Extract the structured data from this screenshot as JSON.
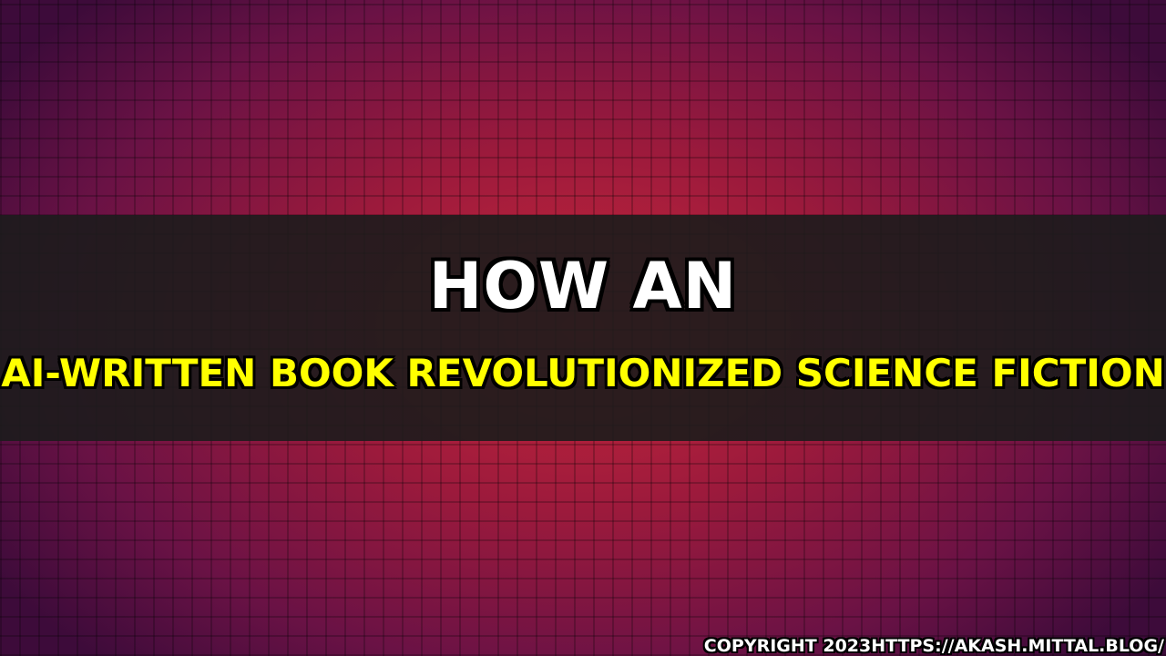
{
  "title": {
    "line1": "HOW AN",
    "line2": "AI-WRITTEN BOOK REVOLUTIONIZED SCIENCE FICTION"
  },
  "footer": {
    "copyright": "COPYRIGHT 2023HTTPS://AKASH.MITTAL.BLOG/"
  },
  "colors": {
    "band": "#1c1c1c",
    "title_line1": "#ffffff",
    "title_line2": "#ffff00",
    "background_center": "#c8273a",
    "background_edge": "#3d0b3a"
  }
}
